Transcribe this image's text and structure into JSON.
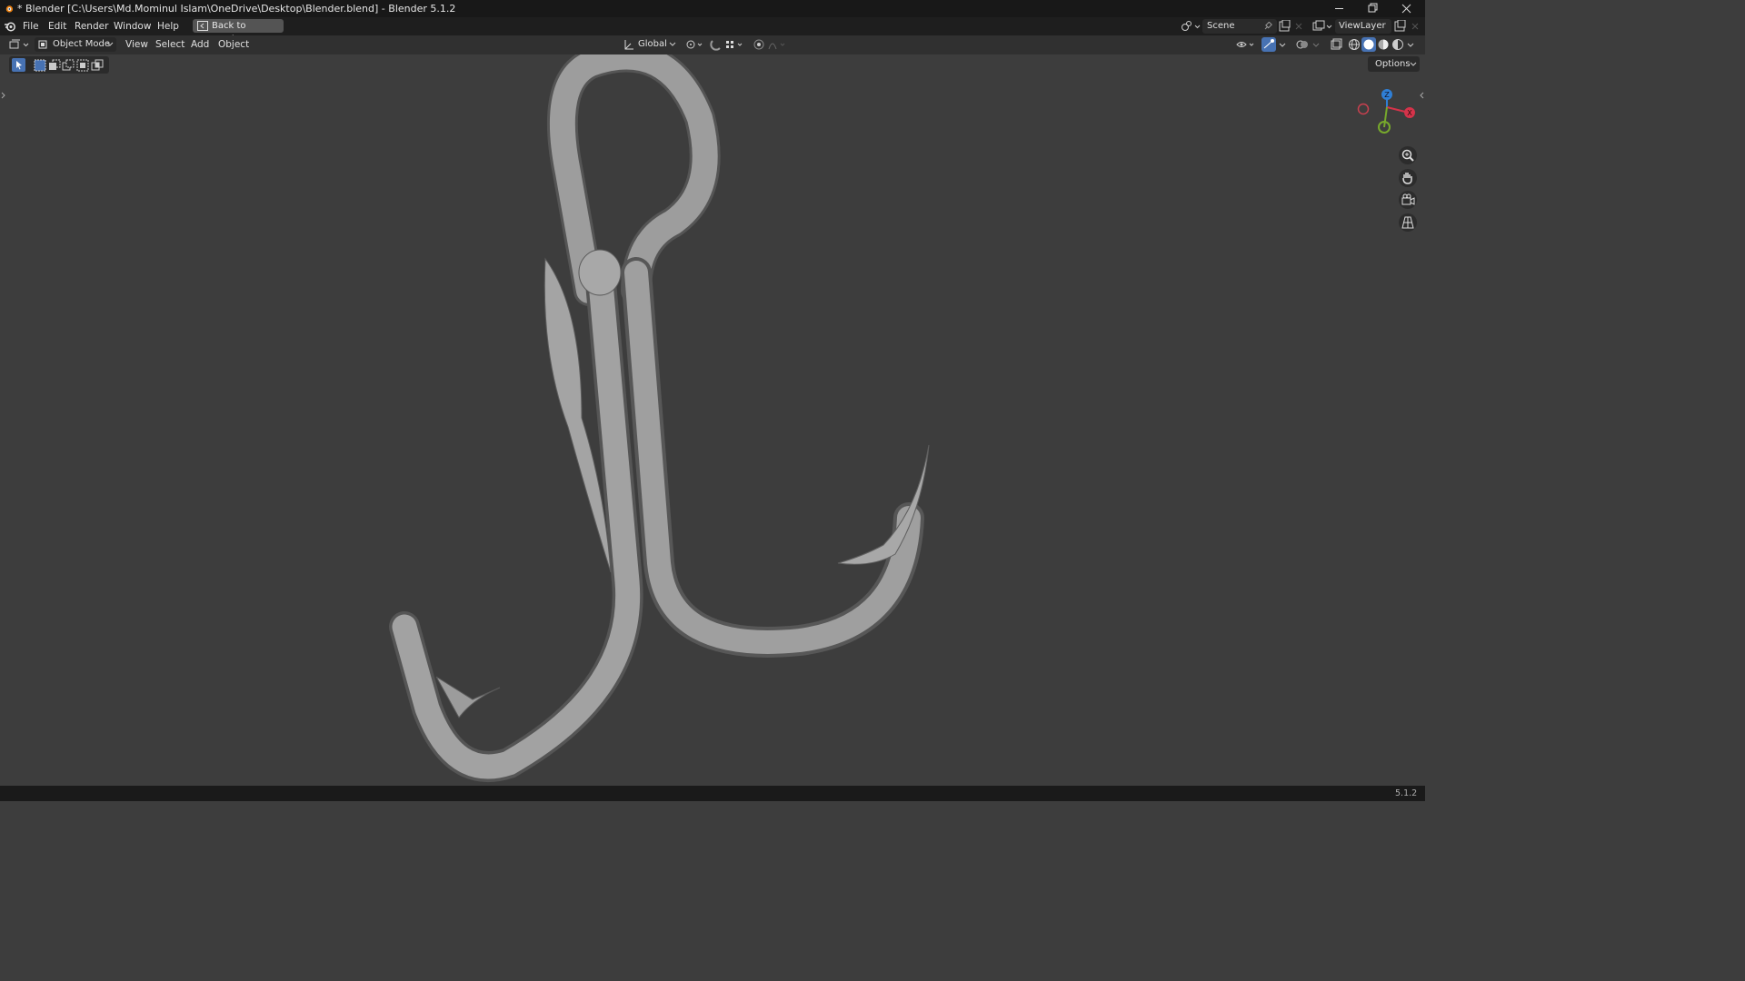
{
  "window": {
    "title": "* Blender [C:\\Users\\Md.Mominul Islam\\OneDrive\\Desktop\\Blender.blend] - Blender 5.1.2",
    "controls": [
      "minimize-icon",
      "restore-icon",
      "close-icon"
    ]
  },
  "menubar": {
    "items": [
      "File",
      "Edit",
      "Render",
      "Window",
      "Help"
    ],
    "back_button": "Back to Previous",
    "scene_label": "Scene",
    "view_layer_label": "ViewLayer"
  },
  "viewport_header": {
    "mode": "Object Mode",
    "menus": [
      "View",
      "Select",
      "Add",
      "Object"
    ],
    "transform_orientation": "Global"
  },
  "viewport": {
    "options_label": "Options",
    "gizmo": {
      "z_label": "Z",
      "x_label": "X",
      "colors": {
        "z": "#2f7fd6",
        "x": "#d5334a",
        "y": "#77a92c"
      }
    },
    "nav_buttons": [
      "zoom-icon",
      "hand-pan-icon",
      "camera-view-icon",
      "perspective-grid-icon"
    ],
    "object": "fishing-hook-mesh"
  },
  "statusbar": {
    "version": "5.1.2"
  },
  "colors": {
    "background": "#3d3d3d",
    "accent": "#4772b3"
  }
}
